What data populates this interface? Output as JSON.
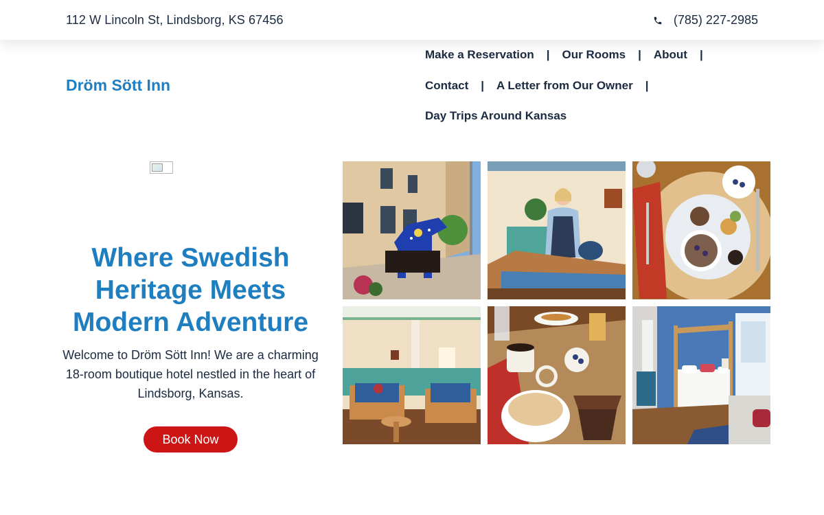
{
  "topbar": {
    "address": "112 W Lincoln St, Lindsborg, KS 67456",
    "phone": "(785) 227-2985",
    "phone_icon": "phone-icon"
  },
  "header": {
    "brand": "Dröm Sött Inn",
    "nav": [
      {
        "label": "Make a Reservation"
      },
      {
        "label": "Our Rooms"
      },
      {
        "label": "About"
      },
      {
        "label": "Contact"
      },
      {
        "label": "A Letter from Our Owner"
      },
      {
        "label": "Day Trips Around Kansas"
      }
    ],
    "separator": "|"
  },
  "hero": {
    "title": "Where Swedish Heritage Meets Modern Adventure",
    "description": "Welcome to Dröm Sött Inn! We are a charming 18-room boutique hotel nestled in the heart of Lindsborg, Kansas.",
    "book_button": "Book Now"
  },
  "gallery": {
    "photos": [
      {
        "subject": "Exterior of inn with blue Dala horse statue"
      },
      {
        "subject": "Staff member polishing wooden counter"
      },
      {
        "subject": "Breakfast plate with fruit and granola"
      },
      {
        "subject": "Lobby lounge with blue sofas"
      },
      {
        "subject": "Breakfast table with pastries and coffee"
      },
      {
        "subject": "Guest room with wooden canopy bed"
      }
    ]
  },
  "colors": {
    "brand_blue": "#1e7ebf",
    "text_navy": "#1b2a40",
    "button_red": "#cc1515"
  }
}
